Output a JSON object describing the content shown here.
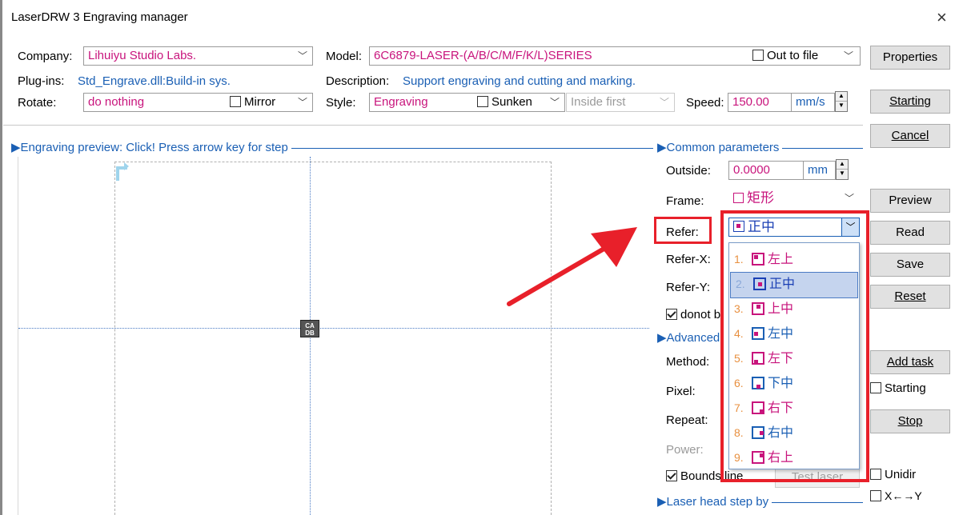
{
  "window": {
    "title": "LaserDRW 3 Engraving manager",
    "close_glyph": "×"
  },
  "top": {
    "company_label": "Company:",
    "company_value": "Lihuiyu Studio Labs.",
    "model_label": "Model:",
    "model_value": "6C6879-LASER-(A/B/C/M/F/K/L)SERIES",
    "out_to_file_label": "Out to file",
    "plugins_label": "Plug-ins:",
    "plugins_value": "Std_Engrave.dll:Build-in sys.",
    "description_label": "Description:",
    "description_value": "Support engraving and cutting and marking.",
    "rotate_label": "Rotate:",
    "rotate_value": "do nothing",
    "mirror_label": "Mirror",
    "style_label": "Style:",
    "style_value": "Engraving",
    "sunken_label": "Sunken",
    "inside_first_value": "Inside first",
    "speed_label": "Speed:",
    "speed_value": "150.00",
    "speed_unit": "mm/s"
  },
  "buttons": {
    "properties": "Properties",
    "starting": "Starting",
    "cancel": "Cancel",
    "preview": "Preview",
    "read": "Read",
    "save": "Save",
    "reset": "Reset",
    "add_task": "Add task",
    "starting_check": "Starting",
    "stop": "Stop",
    "unidir": "Unidir",
    "xy": "X←→Y"
  },
  "preview": {
    "title": "Engraving preview: Click! Press arrow key for step",
    "logo_text": "CA\nDB"
  },
  "common": {
    "title": "Common parameters",
    "outside_label": "Outside:",
    "outside_value": "0.0000",
    "outside_unit": "mm",
    "frame_label": "Frame:",
    "frame_value": "矩形",
    "refer_label": "Refer:",
    "refer_value": "正中",
    "refer_x_label": "Refer-X:",
    "refer_y_label": "Refer-Y:",
    "donot_label": "donot b"
  },
  "advanced": {
    "title": "Advanced",
    "method_label": "Method:",
    "pixel_label": "Pixel:",
    "repeat_label": "Repeat:",
    "power_label": "Power:",
    "bounds_label": "Bounds line",
    "test_laser_label": "Test laser"
  },
  "laser_head": {
    "title": "Laser head step by"
  },
  "dropdown": {
    "items": [
      {
        "num": "1.",
        "text": "左上",
        "color": "#c8147c"
      },
      {
        "num": "2.",
        "text": "正中",
        "color": "#1a3fb4"
      },
      {
        "num": "3.",
        "text": "上中",
        "color": "#c8147c"
      },
      {
        "num": "4.",
        "text": "左中",
        "color": "#1a5fb4"
      },
      {
        "num": "5.",
        "text": "左下",
        "color": "#c8147c"
      },
      {
        "num": "6.",
        "text": "下中",
        "color": "#1a5fb4"
      },
      {
        "num": "7.",
        "text": "右下",
        "color": "#c8147c"
      },
      {
        "num": "8.",
        "text": "右中",
        "color": "#1a5fb4"
      },
      {
        "num": "9.",
        "text": "右上",
        "color": "#c8147c"
      }
    ],
    "selected_index": 1
  },
  "colors": {
    "accent": "#1a5fb4",
    "value": "#c8147c",
    "highlight": "#e8202a",
    "selection": "#c5d4ee"
  }
}
